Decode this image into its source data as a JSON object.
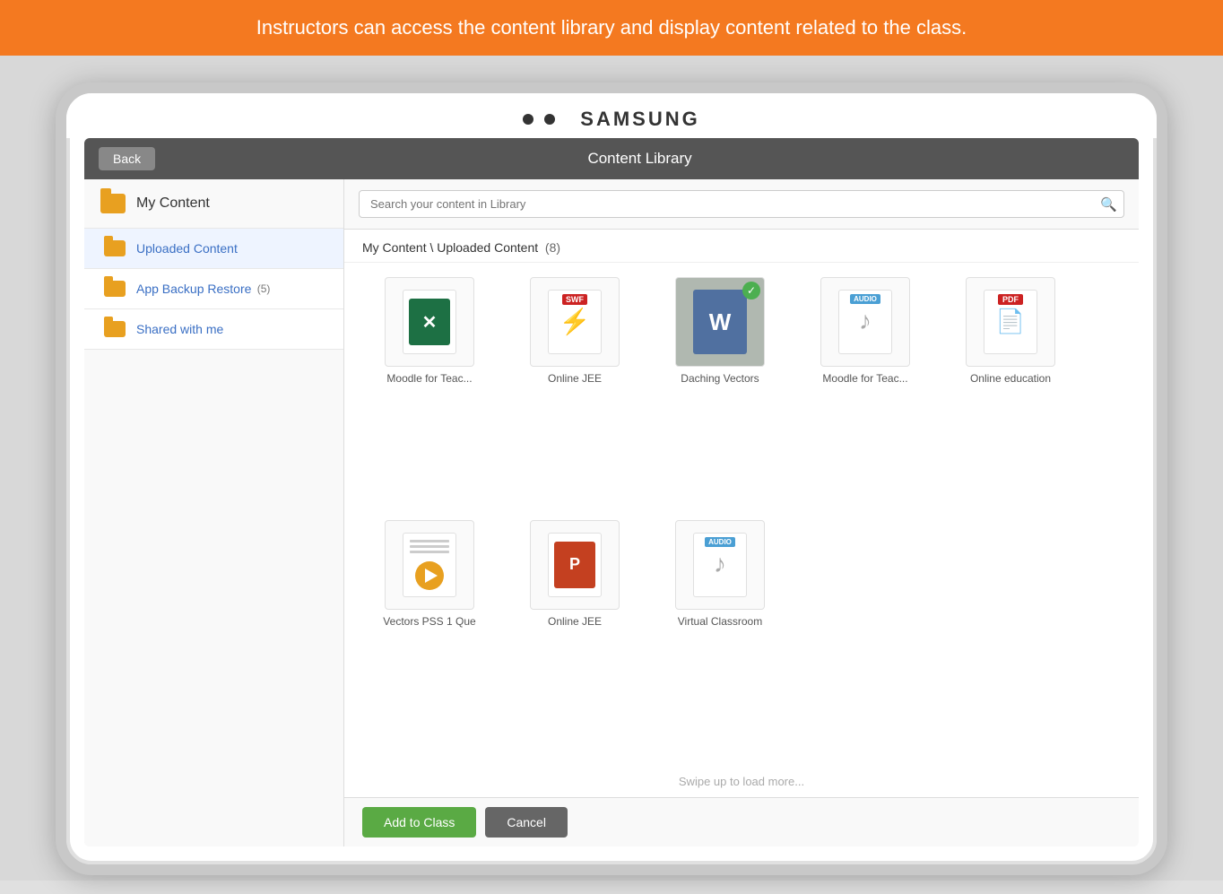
{
  "banner": {
    "text": "Instructors can access the content library and display content related to the class."
  },
  "tablet": {
    "brand": "SAMSUNG"
  },
  "app": {
    "header": {
      "back_label": "Back",
      "title": "Content Library"
    },
    "search": {
      "placeholder": "Search your content in Library"
    },
    "sidebar": {
      "my_content_label": "My Content",
      "items": [
        {
          "label": "Uploaded Content",
          "badge": "",
          "active": true
        },
        {
          "label": "App Backup Restore",
          "badge": "(5)",
          "active": false
        },
        {
          "label": "Shared with me",
          "badge": "",
          "active": false
        }
      ]
    },
    "breadcrumb": {
      "path": "My Content \\ Uploaded Content",
      "count": "(8)"
    },
    "content_items": [
      {
        "name": "Moodle for Teac...",
        "type": "excel",
        "selected": false
      },
      {
        "name": "Online JEE",
        "type": "swf",
        "selected": false
      },
      {
        "name": "Daching Vectors",
        "type": "word",
        "selected": true
      },
      {
        "name": "Moodle for Teac...",
        "type": "audio",
        "selected": false
      },
      {
        "name": "Online education",
        "type": "pdf",
        "selected": false
      },
      {
        "name": "Vectors PSS 1 Que",
        "type": "video",
        "selected": false
      },
      {
        "name": "Online JEE",
        "type": "ppt",
        "selected": false
      },
      {
        "name": "Virtual Classroom",
        "type": "audio2",
        "selected": false
      }
    ],
    "load_more": "Swipe up to load more...",
    "buttons": {
      "add_label": "Add to Class",
      "cancel_label": "Cancel"
    }
  }
}
